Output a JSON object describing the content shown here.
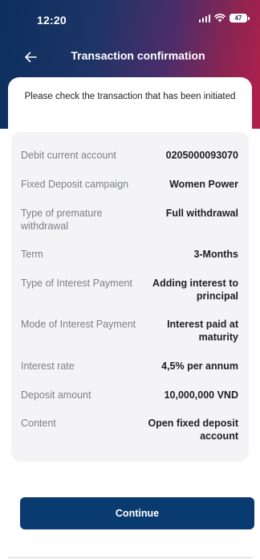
{
  "status_bar": {
    "time": "12:20",
    "battery": "47"
  },
  "nav": {
    "title": "Transaction confirmation"
  },
  "intro_text": "Please check the transaction that has been initiated",
  "details": [
    {
      "label": "Debit current account",
      "value": "0205000093070"
    },
    {
      "label": "Fixed Deposit campaign",
      "value": "Women Power"
    },
    {
      "label": "Type of premature withdrawal",
      "value": "Full withdrawal"
    },
    {
      "label": "Term",
      "value": "3-Months"
    },
    {
      "label": "Type of Interest Payment",
      "value": "Adding interest to principal"
    },
    {
      "label": "Mode of Interest Payment",
      "value": "Interest paid at maturity"
    },
    {
      "label": "Interest rate",
      "value": "4,5% per annum"
    },
    {
      "label": "Deposit amount",
      "value": "10,000,000 VND"
    },
    {
      "label": "Content",
      "value": "Open fixed deposit account"
    }
  ],
  "continue_label": "Continue",
  "colors": {
    "header_gradient_start": "#0b2f5e",
    "header_gradient_end": "#b3204a",
    "primary_button": "#0a3b70",
    "label_text": "#7c7f86",
    "value_text": "#1f1f1f",
    "details_background": "#f4f4f6"
  },
  "icons": {
    "back": "arrow-left-icon",
    "signal": "signal-icon",
    "wifi": "wifi-icon",
    "battery": "battery-icon"
  }
}
